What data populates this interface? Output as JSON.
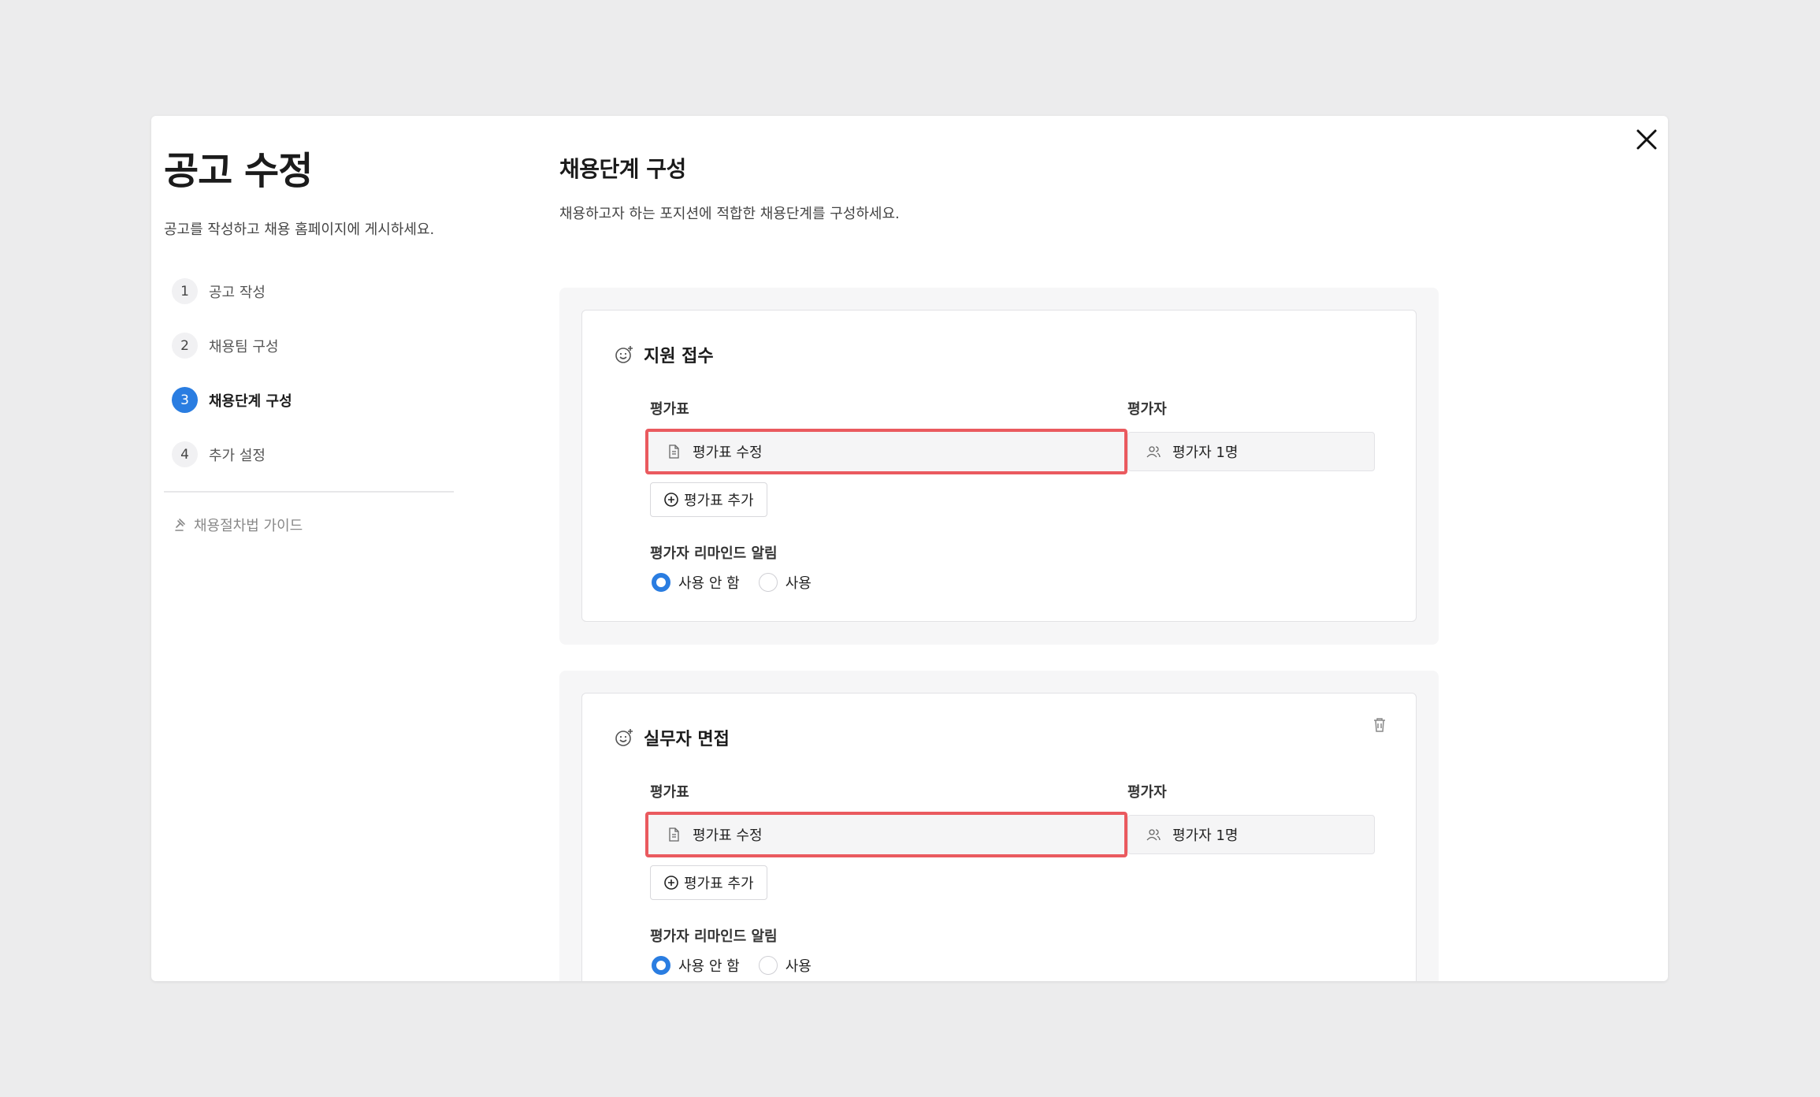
{
  "sidebar": {
    "title": "공고 수정",
    "description": "공고를 작성하고 채용 홈페이지에 게시하세요.",
    "steps": [
      {
        "num": "1",
        "label": "공고 작성"
      },
      {
        "num": "2",
        "label": "채용팀 구성"
      },
      {
        "num": "3",
        "label": "채용단계 구성"
      },
      {
        "num": "4",
        "label": "추가 설정"
      }
    ],
    "active_step": "3",
    "guide_label": "채용절차법 가이드"
  },
  "main": {
    "title": "채용단계 구성",
    "description": "채용하고자 하는 포지션에 적합한 채용단계를 구성하세요.",
    "stages": [
      {
        "name": "지원 접수",
        "scorecard_label": "평가표",
        "scorecard_value": "평가표 수정",
        "evaluator_label": "평가자",
        "evaluator_value": "평가자 1명",
        "add_scorecard": "평가표 추가",
        "reminder_label": "평가자 리마인드 알림",
        "options": [
          "사용 안 함",
          "사용"
        ],
        "selected": "사용 안 함"
      },
      {
        "name": "실무자 면접",
        "scorecard_label": "평가표",
        "scorecard_value": "평가표 수정",
        "evaluator_label": "평가자",
        "evaluator_value": "평가자 1명",
        "add_scorecard": "평가표 추가",
        "reminder_label": "평가자 리마인드 알림",
        "options": [
          "사용 안 함",
          "사용"
        ],
        "selected": "사용 안 함"
      }
    ]
  },
  "colors": {
    "accent": "#2a7de1",
    "highlight": "#ea5a5f",
    "background": "#ececed"
  }
}
